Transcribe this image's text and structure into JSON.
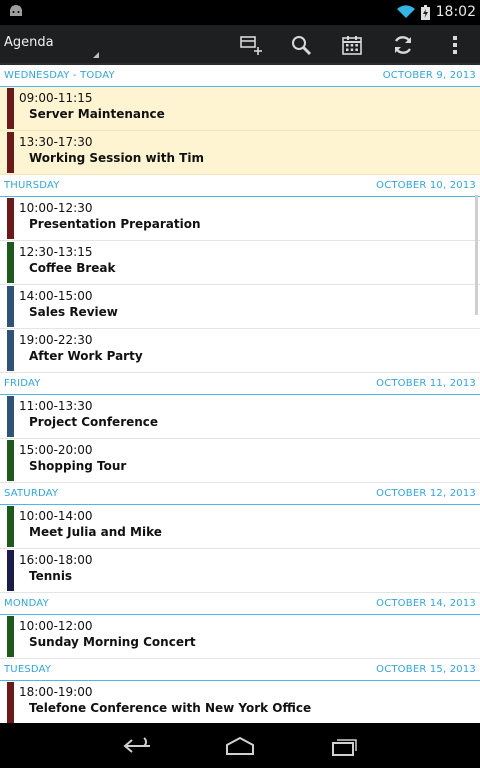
{
  "status_bar": {
    "time": "18:02"
  },
  "action_bar": {
    "title": "Agenda",
    "actions": [
      {
        "icon": "new-event-icon"
      },
      {
        "icon": "search-icon"
      },
      {
        "icon": "calendar-icon"
      },
      {
        "icon": "refresh-icon"
      },
      {
        "icon": "overflow-menu-icon"
      }
    ]
  },
  "colors": {
    "accent": "#33a5d6",
    "today_bg": "#fff4d1",
    "maroon": "#6b1a1a",
    "green": "#1e5a1e",
    "blue": "#2e5278",
    "navy": "#1c1c4a"
  },
  "days": [
    {
      "name": "WEDNESDAY - TODAY",
      "date": "OCTOBER 9, 2013",
      "today": true,
      "events": [
        {
          "time": "09:00-11:15",
          "title": "Server Maintenance",
          "color": "#6b1a1a"
        },
        {
          "time": "13:30-17:30",
          "title": "Working Session with Tim",
          "color": "#6b1a1a"
        }
      ]
    },
    {
      "name": "THURSDAY",
      "date": "OCTOBER 10, 2013",
      "events": [
        {
          "time": "10:00-12:30",
          "title": "Presentation Preparation",
          "color": "#6b1a1a"
        },
        {
          "time": "12:30-13:15",
          "title": "Coffee Break",
          "color": "#1e5a1e"
        },
        {
          "time": "14:00-15:00",
          "title": "Sales Review",
          "color": "#2e5278"
        },
        {
          "time": "19:00-22:30",
          "title": "After Work Party",
          "color": "#2e5278"
        }
      ]
    },
    {
      "name": "FRIDAY",
      "date": "OCTOBER 11, 2013",
      "events": [
        {
          "time": "11:00-13:30",
          "title": "Project Conference",
          "color": "#2e5278"
        },
        {
          "time": "15:00-20:00",
          "title": "Shopping Tour",
          "color": "#1e5a1e"
        }
      ]
    },
    {
      "name": "SATURDAY",
      "date": "OCTOBER 12, 2013",
      "events": [
        {
          "time": "10:00-14:00",
          "title": "Meet Julia and Mike",
          "color": "#1e5a1e"
        },
        {
          "time": "16:00-18:00",
          "title": "Tennis",
          "color": "#1c1c4a"
        }
      ]
    },
    {
      "name": "MONDAY",
      "date": "OCTOBER 14, 2013",
      "events": [
        {
          "time": "10:00-12:00",
          "title": "Sunday Morning Concert",
          "color": "#1e5a1e"
        }
      ]
    },
    {
      "name": "TUESDAY",
      "date": "OCTOBER 15, 2013",
      "events": [
        {
          "time": "18:00-19:00",
          "title": "Telefone Conference with New York Office",
          "color": "#6b1a1a"
        }
      ]
    }
  ],
  "nav_bar": [
    {
      "icon": "back-icon"
    },
    {
      "icon": "home-icon"
    },
    {
      "icon": "recent-apps-icon"
    }
  ]
}
